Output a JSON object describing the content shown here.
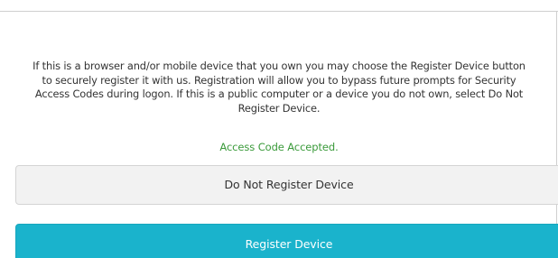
{
  "message": {
    "lines": [
      "If this is a browser and/or mobile device that you own you may choose the Register Device button",
      "to securely register it with us. Registration will allow you to bypass future prompts for Security",
      "Access Codes during logon. If this is a public computer or a device you do not own, select Do Not",
      "Register Device."
    ]
  },
  "status": {
    "text": "Access Code Accepted.",
    "color": "#3a9a3a"
  },
  "buttons": {
    "do_not_register_label": "Do Not Register Device",
    "register_label": "Register Device"
  },
  "colors": {
    "primary": "#1ab3cc",
    "secondary_bg": "#f2f2f2",
    "border": "#cfcfcf"
  }
}
